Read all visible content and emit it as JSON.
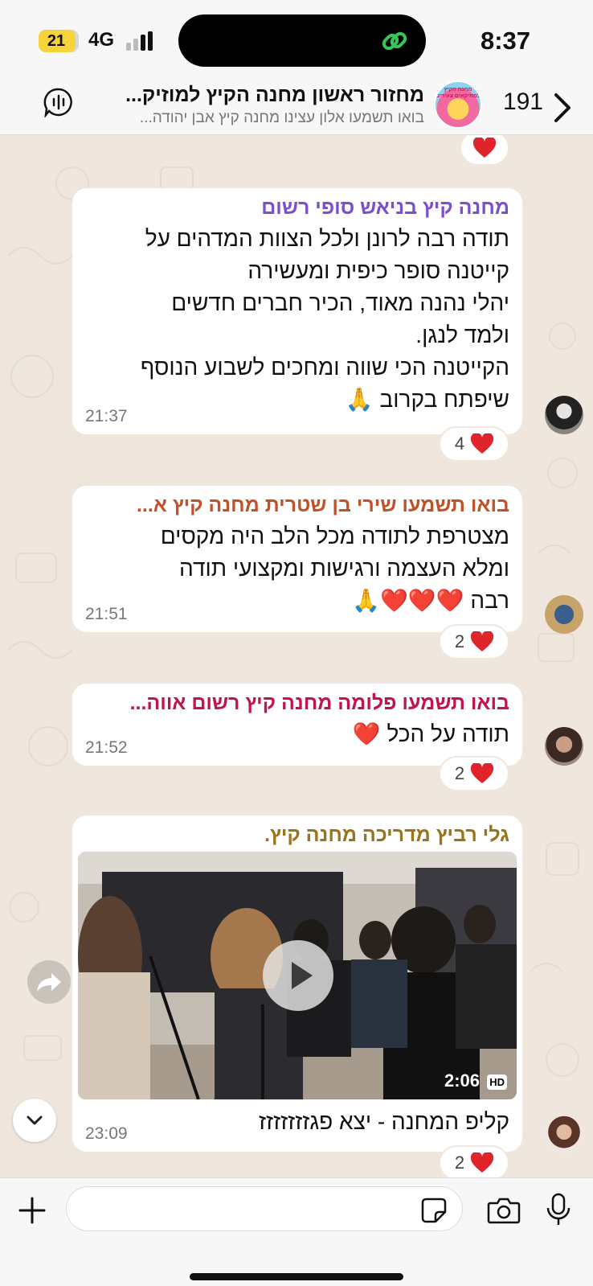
{
  "status_bar": {
    "battery": "21",
    "network": "4G",
    "time": "8:37"
  },
  "header": {
    "unread_count": "191",
    "title": "מחזור ראשון מחנה הקיץ למוזיק...",
    "subtitle": "בואו תשמעו אלון עצינו מחנה קיץ אבן יהודה...",
    "avatar_text": "מחנה הקיץ למוזיקאים צעירים"
  },
  "messages": [
    {
      "sender": "מחנה קיץ בניאש סופי רשום",
      "sender_color": "#7a4fd0",
      "lines": [
        "תודה רבה לרונן ולכל הצוות המדהים על",
        "קייטנה סופר כיפית ומעשירה",
        "יהלי נהנה מאוד, הכיר חברים חדשים",
        "ולמד לנגן.",
        "הקייטנה הכי שווה ומחכים לשבוע הנוסף",
        "שיפתח בקרוב 🙏"
      ],
      "time": "21:37",
      "reaction_count": "4"
    },
    {
      "sender": "בואו תשמעו שירי בן שטרית מחנה קיץ א...",
      "sender_color": "#c0522a",
      "lines": [
        "מצטרפת לתודה מכל הלב היה מקסים",
        "ומלא העצמה ורגישות ומקצועי  תודה",
        "רבה ❤️❤️❤️🙏"
      ],
      "time": "21:51",
      "reaction_count": "2"
    },
    {
      "sender": "בואו תשמעו פלומה מחנה קיץ רשום אווה...",
      "sender_color": "#c4124a",
      "lines": [
        "תודה על הכל ❤️"
      ],
      "time": "21:52",
      "reaction_count": "2"
    },
    {
      "sender": "גלי רביץ מדריכה מחנה קיץ.",
      "sender_color": "#9a7418",
      "video_duration": "2:06",
      "video_badge": "HD",
      "caption": "קליפ המחנה - יצא פגזזזזזזז",
      "time": "23:09",
      "reaction_count": "2"
    }
  ],
  "input": {
    "placeholder": ""
  }
}
